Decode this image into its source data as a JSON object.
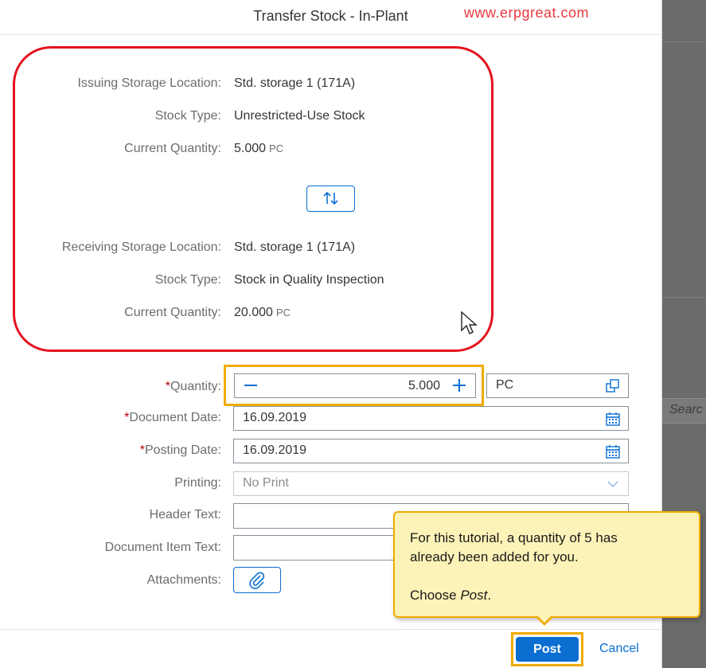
{
  "watermark": "www.erpgreat.com",
  "dialog": {
    "title": "Transfer Stock - In-Plant"
  },
  "issuing": {
    "location_label": "Issuing Storage Location:",
    "location_value": "Std. storage 1 (171A)",
    "stock_type_label": "Stock Type:",
    "stock_type_value": "Unrestricted-Use Stock",
    "quantity_label": "Current Quantity:",
    "quantity_value": "5.000",
    "quantity_unit": "PC"
  },
  "swap_icon": "swap-arrows-icon",
  "receiving": {
    "location_label": "Receiving Storage Location:",
    "location_value": "Std. storage 1 (171A)",
    "stock_type_label": "Stock Type:",
    "stock_type_value": "Stock in Quality Inspection",
    "quantity_label": "Current Quantity:",
    "quantity_value": "20.000",
    "quantity_unit": "PC"
  },
  "form": {
    "required_marker": "*",
    "quantity": {
      "label": "Quantity:",
      "value": "5.000",
      "unit": "PC"
    },
    "document_date": {
      "label": "Document Date:",
      "value": "16.09.2019"
    },
    "posting_date": {
      "label": "Posting Date:",
      "value": "16.09.2019"
    },
    "printing": {
      "label": "Printing:",
      "placeholder": "No Print"
    },
    "header_text": {
      "label": "Header Text:",
      "value": ""
    },
    "item_text": {
      "label": "Document Item Text:",
      "value": ""
    },
    "attachments": {
      "label": "Attachments:"
    }
  },
  "footer": {
    "post_label": "Post",
    "cancel_label": "Cancel"
  },
  "callout": {
    "line1": "For this tutorial, a quantity of 5 has",
    "line2": "already been added for you.",
    "line3_prefix": "Choose ",
    "line3_emph": "Post",
    "line3_suffix": "."
  },
  "background": {
    "search_placeholder": "Searc"
  },
  "colors": {
    "accent": "#0a6ed1",
    "highlight": "#f0ab00",
    "annotation_red": "#e5121e",
    "callout_bg": "#fdf3b8",
    "required": "#bb0000"
  }
}
